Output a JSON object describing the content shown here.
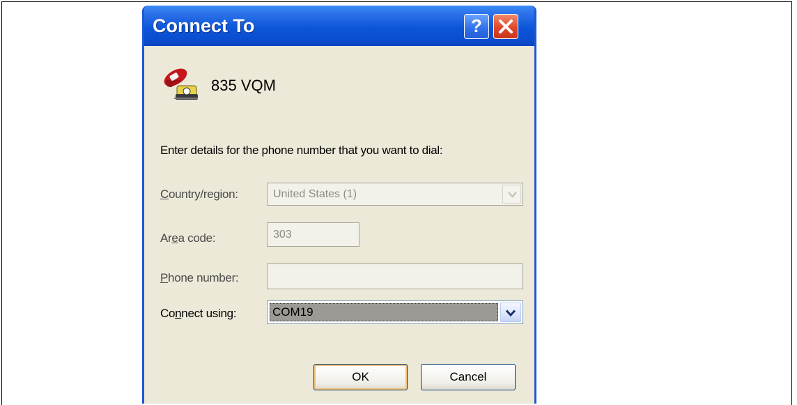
{
  "window": {
    "title": "Connect To",
    "help_label": "?",
    "connection_name": "835 VQM",
    "phone_icon": "telephone-modem-icon"
  },
  "form": {
    "prompt": "Enter details for the phone number that you want to dial:",
    "country": {
      "label_pre": "",
      "label_u": "C",
      "label_post": "ountry/region:",
      "value": "United States (1)",
      "enabled": false
    },
    "area_code": {
      "label_pre": "Ar",
      "label_u": "e",
      "label_post": "a code:",
      "value": "303",
      "enabled": false
    },
    "phone_number": {
      "label_pre": "",
      "label_u": "P",
      "label_post": "hone number:",
      "value": "",
      "enabled": false
    },
    "connect_using": {
      "label_pre": "Co",
      "label_u": "n",
      "label_post": "nect using:",
      "value": "COM19",
      "enabled": true
    }
  },
  "buttons": {
    "ok": "OK",
    "cancel": "Cancel"
  },
  "colors": {
    "titlebar": "#0a4dcf",
    "dialog_bg": "#ece9d8",
    "close": "#e0492a"
  }
}
